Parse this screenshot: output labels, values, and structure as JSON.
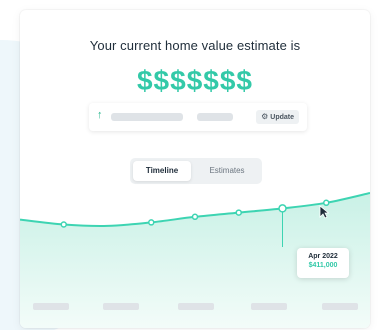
{
  "estimate": {
    "headline": "Your current home value estimate is",
    "value": "$$$$$$$"
  },
  "update_bar": {
    "trend_icon": "arrow-up-icon",
    "button_icon": "gear-icon",
    "button_label": "Update"
  },
  "tabs": [
    {
      "label": "Timeline",
      "active": true
    },
    {
      "label": "Estimates",
      "active": false
    }
  ],
  "tooltip": {
    "date": "Apr 2022",
    "value": "$411,000"
  },
  "colors": {
    "accent": "#33c9a8",
    "line": "#3dd4b2",
    "area_top": "#c9f1e6",
    "area_bottom": "#f3fcf9",
    "skeleton": "#dfe3e7"
  },
  "chart_data": {
    "type": "area",
    "series": [
      {
        "values": [
          0.62,
          0.55,
          0.53,
          0.58,
          0.66,
          0.72,
          0.78,
          0.86,
          1.0
        ]
      }
    ],
    "marked_points": [
      1,
      3,
      4,
      5,
      6,
      7
    ],
    "highlight_index": 6
  }
}
